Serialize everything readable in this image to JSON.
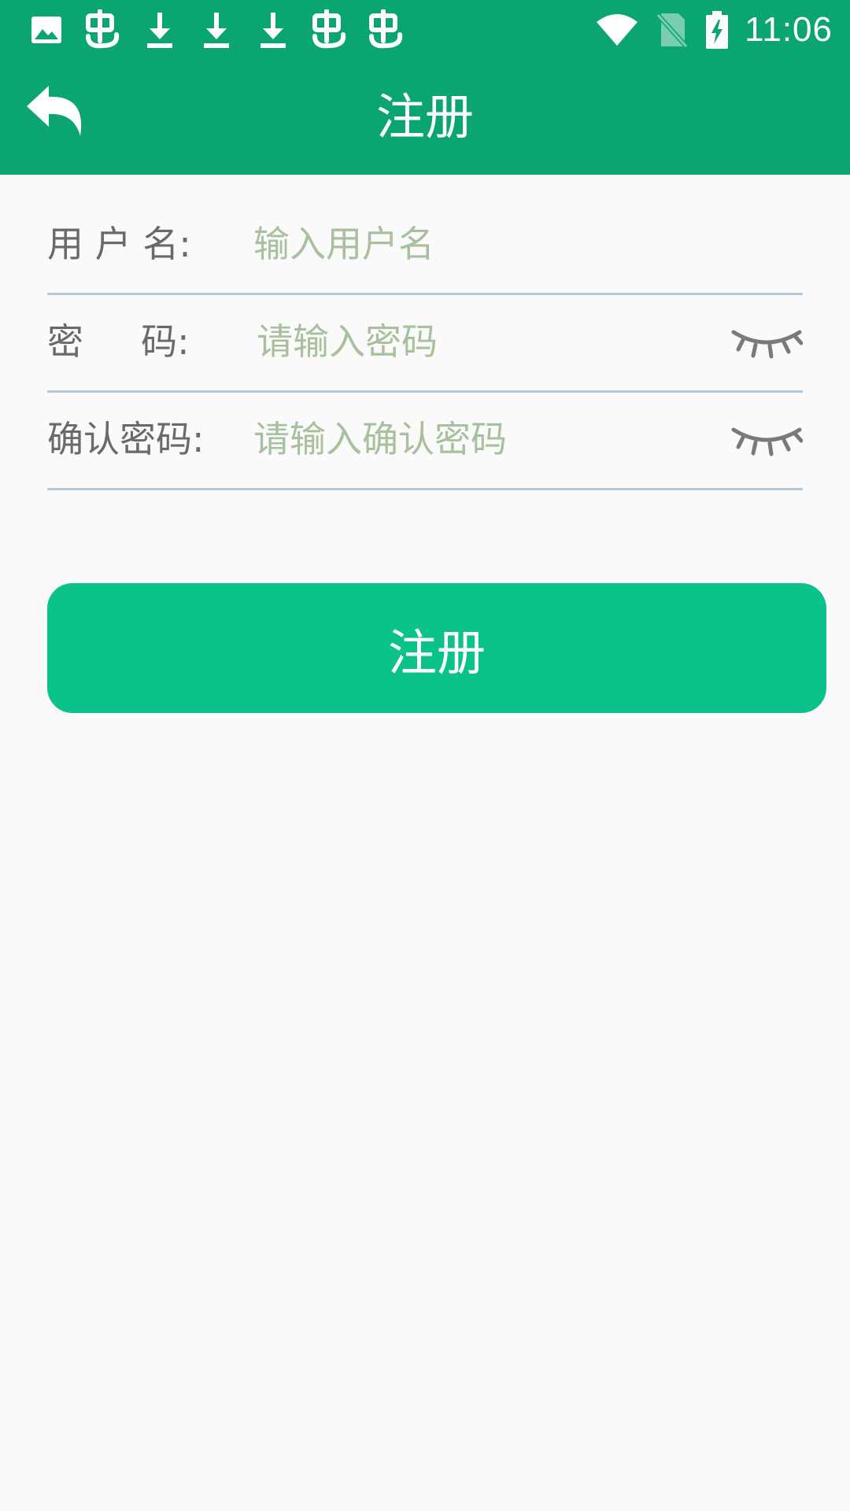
{
  "status_bar": {
    "time": "11:06",
    "left_icons": [
      "image-icon",
      "bug-icon",
      "download-icon",
      "download-icon",
      "download-icon",
      "bug-icon",
      "bug-icon"
    ],
    "right_icons": [
      "wifi-icon",
      "no-sim-icon",
      "battery-charging-icon"
    ]
  },
  "app_bar": {
    "title": "注册",
    "back_icon": "back-arrow-icon"
  },
  "form": {
    "username": {
      "label": "用 户 名:",
      "placeholder": "输入用户名",
      "value": ""
    },
    "password": {
      "label": "密     码:",
      "placeholder": "请输入密码",
      "value": "",
      "toggle_icon": "eye-closed-icon"
    },
    "confirm_password": {
      "label": "确认密码:",
      "placeholder": "请输入确认密码",
      "value": "",
      "toggle_icon": "eye-closed-icon"
    }
  },
  "register_button": {
    "label": "注册"
  },
  "colors": {
    "header": "#0aa573",
    "button": "#0bc28a",
    "background": "#fafafa",
    "placeholder": "#a8c09e",
    "underline": "#b3c6da",
    "label": "#6a6a6a"
  }
}
